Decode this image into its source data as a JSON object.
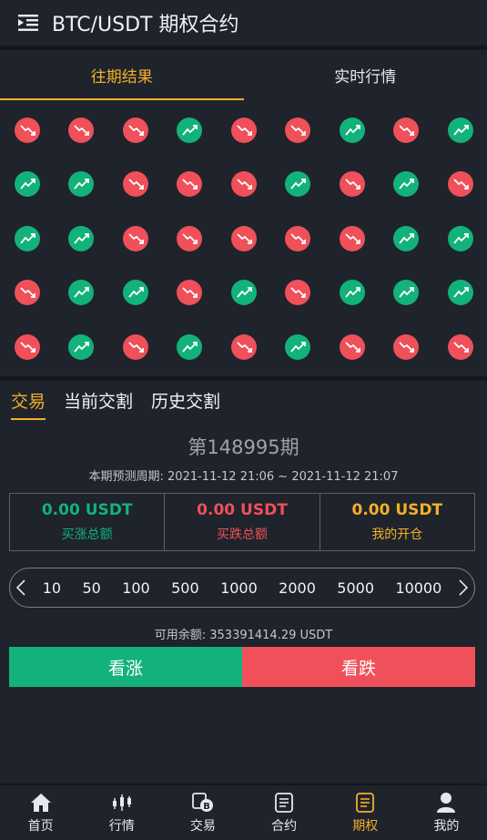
{
  "header": {
    "title": "BTC/USDT 期权合约",
    "menu_icon": "menu-indent-icon"
  },
  "tabs": [
    {
      "label": "往期结果",
      "active": true
    },
    {
      "label": "实时行情",
      "active": false
    }
  ],
  "results": [
    "down",
    "down",
    "down",
    "up",
    "down",
    "down",
    "up",
    "down",
    "up",
    "up",
    "up",
    "down",
    "down",
    "down",
    "up",
    "down",
    "up",
    "down",
    "up",
    "up",
    "down",
    "down",
    "down",
    "down",
    "down",
    "up",
    "up",
    "down",
    "up",
    "up",
    "down",
    "up",
    "down",
    "up",
    "up",
    "up",
    "down",
    "up",
    "down",
    "up",
    "down",
    "up",
    "down",
    "down",
    "down"
  ],
  "colors": {
    "up": "#12b27a",
    "down": "#ef505a",
    "accent": "#f2b02a"
  },
  "subtabs": [
    {
      "label": "交易",
      "active": true
    },
    {
      "label": "当前交割",
      "active": false
    },
    {
      "label": "历史交割",
      "active": false
    }
  ],
  "period": "第148995期",
  "cycle": "本期预测周期: 2021-11-12 21:06 ~ 2021-11-12 21:07",
  "totals": [
    {
      "value": "0.00 USDT",
      "label": "买涨总额",
      "color": "#12b27a"
    },
    {
      "value": "0.00 USDT",
      "label": "买跌总额",
      "color": "#ef505a"
    },
    {
      "value": "0.00 USDT",
      "label": "我的开仓",
      "color": "#f2b02a"
    }
  ],
  "amounts": [
    "10",
    "50",
    "100",
    "500",
    "1000",
    "2000",
    "5000",
    "10000"
  ],
  "balance": "可用余额: 353391414.29 USDT",
  "buttons": {
    "up": "看涨",
    "down": "看跌"
  },
  "nav": [
    {
      "label": "首页",
      "icon": "home-icon",
      "active": false
    },
    {
      "label": "行情",
      "icon": "candlestick-icon",
      "active": false
    },
    {
      "label": "交易",
      "icon": "bitcoin-exchange-icon",
      "active": false
    },
    {
      "label": "合约",
      "icon": "document-icon",
      "active": false
    },
    {
      "label": "期权",
      "icon": "document-icon",
      "active": true
    },
    {
      "label": "我的",
      "icon": "user-icon",
      "active": false
    }
  ]
}
